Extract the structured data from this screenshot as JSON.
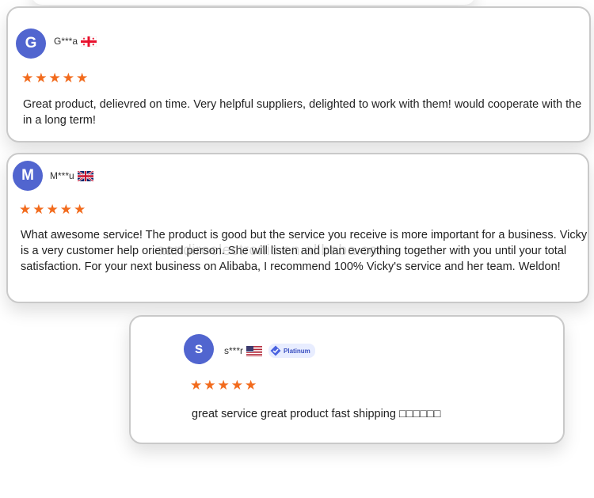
{
  "reviews": [
    {
      "initial": "G",
      "name": "G***a",
      "flag_icon": "georgia-flag-icon",
      "rating": 5,
      "text": "Great product, delievred on time. Very helpful suppliers, delighted to work with them! would cooperate with the in a long term!"
    },
    {
      "initial": "M",
      "name": "M***u",
      "flag_icon": "uk-flag-icon",
      "rating": 5,
      "text": "What awesome service! The product is good but the service you receive is more important for a business. Vicky is a very customer help oriented person. She will listen and plan everything together with you until your total satisfaction. For your next business on Alibaba, I recommend 100% Vicky's service and her team. Weldon!"
    },
    {
      "initial": "s",
      "name": "s***r",
      "flag_icon": "usa-flag-icon",
      "badge": "Platinum",
      "rating": 5,
      "text": "great service great product fast shipping □□□□□□"
    }
  ],
  "watermark": "aandiroelectronic.en.alibaba.com",
  "colors": {
    "avatar": "#5165cf",
    "star": "#f26b1d",
    "border": "#c9c9c9"
  }
}
